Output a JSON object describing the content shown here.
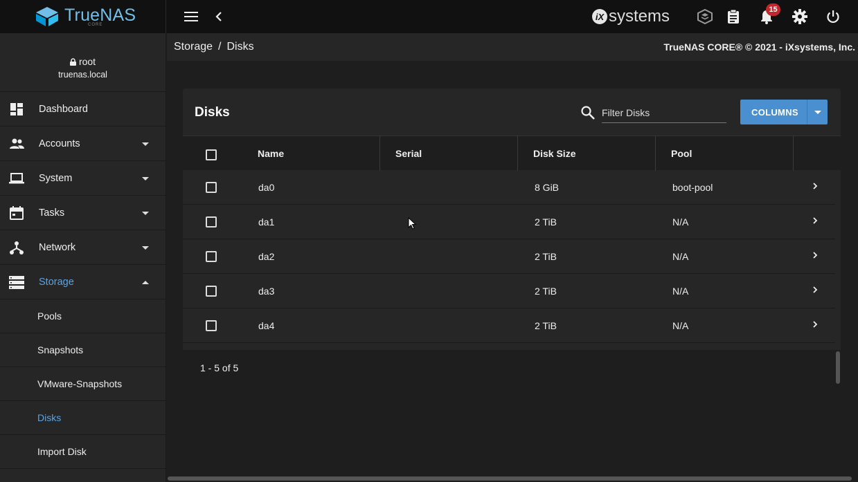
{
  "brand": {
    "name": "TrueNAS",
    "sub": "CORE",
    "vendor_logo": "systems"
  },
  "topbar": {
    "icons": [
      "menu-icon",
      "back-chevron-icon",
      "truecommand-icon",
      "clipboard-icon",
      "bell-icon",
      "gear-icon",
      "power-icon"
    ],
    "notification_count": "15"
  },
  "user": {
    "name": "root",
    "host": "truenas.local"
  },
  "sidebar": {
    "items": [
      {
        "label": "Dashboard",
        "icon": "dashboard-icon"
      },
      {
        "label": "Accounts",
        "icon": "accounts-icon"
      },
      {
        "label": "System",
        "icon": "laptop-icon"
      },
      {
        "label": "Tasks",
        "icon": "calendar-icon"
      },
      {
        "label": "Network",
        "icon": "network-icon"
      },
      {
        "label": "Storage",
        "icon": "storage-icon"
      }
    ],
    "storage_sub": [
      {
        "label": "Pools"
      },
      {
        "label": "Snapshots"
      },
      {
        "label": "VMware-Snapshots"
      },
      {
        "label": "Disks"
      },
      {
        "label": "Import Disk"
      }
    ]
  },
  "breadcrumb": {
    "parent": "Storage",
    "sep": "/",
    "current": "Disks"
  },
  "copyright": "TrueNAS CORE® © 2021 - iXsystems, Inc.",
  "card": {
    "title": "Disks",
    "filter_placeholder": "Filter Disks",
    "columns_button": "COLUMNS",
    "headers": [
      "Name",
      "Serial",
      "Disk Size",
      "Pool"
    ],
    "rows": [
      {
        "name": "da0",
        "serial": "",
        "size": "8 GiB",
        "pool": "boot-pool"
      },
      {
        "name": "da1",
        "serial": "",
        "size": "2 TiB",
        "pool": "N/A"
      },
      {
        "name": "da2",
        "serial": "",
        "size": "2 TiB",
        "pool": "N/A"
      },
      {
        "name": "da3",
        "serial": "",
        "size": "2 TiB",
        "pool": "N/A"
      },
      {
        "name": "da4",
        "serial": "",
        "size": "2 TiB",
        "pool": "N/A"
      }
    ],
    "pagination": "1 - 5 of 5"
  },
  "colors": {
    "accent": "#58a5e6",
    "button": "#4a8fcf",
    "badge": "#c1272d"
  }
}
